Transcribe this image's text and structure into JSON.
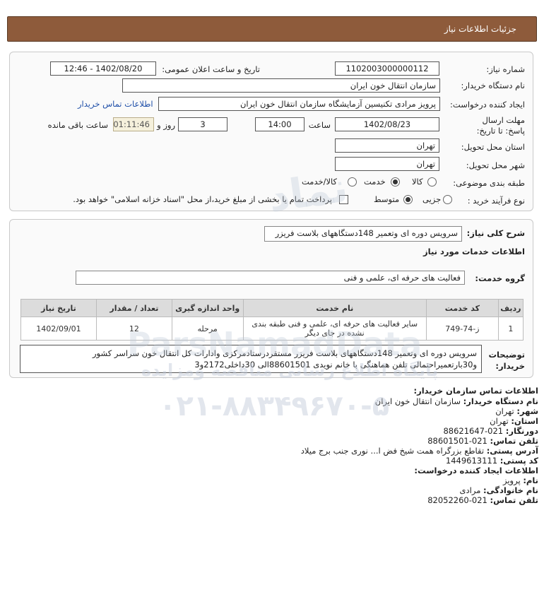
{
  "header": {
    "title": "جزئیات اطلاعات نیاز"
  },
  "need": {
    "need_number_label": "شماره نیاز:",
    "need_number": "1102003000000112",
    "announce_label": "تاریخ و ساعت اعلان عمومی:",
    "announce_value": "1402/08/20 - 12:46",
    "buyer_label": "نام دستگاه خریدار:",
    "buyer_value": "سازمان انتقال خون ایران",
    "creator_label": "ایجاد کننده درخواست:",
    "creator_value": "پرویز مرادی تکنیسین آزمایشگاه سازمان انتقال خون ایران",
    "contact_link": "اطلاعات تماس خریدار",
    "deadline_label": "مهلت ارسال پاسخ: تا تاریخ:",
    "deadline_date": "1402/08/23",
    "time_label": "ساعت",
    "deadline_time": "14:00",
    "days_value": "3",
    "days_label": "روز و",
    "remaining_time": "01:11:46",
    "remaining_label": "ساعت باقی مانده",
    "province_label": "استان محل تحویل:",
    "province_value": "تهران",
    "city_label": "شهر محل تحویل:",
    "city_value": "تهران",
    "category_label": "طبقه بندی موضوعی:",
    "category_options": [
      "کالا",
      "خدمت",
      "کالا/خدمت"
    ],
    "category_selected": "خدمت",
    "process_label": "نوع فرآیند خرید :",
    "process_options": [
      "جزیی",
      "متوسط"
    ],
    "process_selected": "متوسط",
    "payment_text": "پرداخت تمام یا بخشی از مبلغ خرید،از محل \"اسناد خزانه اسلامی\" خواهد بود."
  },
  "details": {
    "general_label": "شرح کلی نیاز:",
    "general_value": "سرویس دوره ای وتعمیر 148دستگاههای بلاست فریزر",
    "services_header": "اطلاعات خدمات مورد نیاز",
    "group_label": "گروه خدمت:",
    "group_value": "فعالیت های حرفه ای، علمی و فنی",
    "table": {
      "columns": [
        "ردیف",
        "کد خدمت",
        "نام خدمت",
        "واحد اندازه گیری",
        "تعداد / مقدار",
        "تاریخ نیاز"
      ],
      "rows": [
        {
          "row": "1",
          "code": "ز-74-749",
          "name": "سایر فعالیت های حرفه ای، علمی و فنی طبقه بندی نشده در جای دیگر",
          "unit": "مرحله",
          "qty": "12",
          "date": "1402/09/01"
        }
      ]
    },
    "buyer_desc_label": "توضیحات خریدار:",
    "buyer_desc": "سرویس دوره ای وتعمیر 148دستگاههای بلاست فریزر مستقردرستادمرکزی وادارات کل انتقال خون سراسر کشور و30بارتعمیراحتمالی تلفن هماهنگی با خانم نویدی 88601501الی 30داخلی2172و3"
  },
  "contact": {
    "heading": "اطلاعات تماس سازمان خریدار:",
    "items": [
      {
        "label": "نام دستگاه خریدار:",
        "value": "سازمان انتقال خون ایران"
      },
      {
        "label": "شهر:",
        "value": "تهران"
      },
      {
        "label": "استان:",
        "value": "تهران"
      },
      {
        "label": "دورنگار:",
        "value": "021-88621647"
      },
      {
        "label": "تلفن تماس:",
        "value": "021-88601501"
      },
      {
        "label": "آدرس پستی:",
        "value": "تقاطع بزرگراه همت شیخ فض ا... نوری جنب برج میلاد"
      },
      {
        "label": "کد پستی:",
        "value": "1449613111"
      }
    ],
    "creator_heading": "اطلاعات ایجاد کننده درخواست:",
    "creator_items": [
      {
        "label": "نام:",
        "value": "پرویز"
      },
      {
        "label": "نام خانوادگی:",
        "value": "مرادی"
      },
      {
        "label": "تلفن تماس:",
        "value": "021-82052260"
      }
    ]
  },
  "watermark": {
    "site": "ParsNamadData",
    "caption": "پایگاه اطلاع رسانی مناقصه ومزایده",
    "phone": "۰۲۱-۸۸۳۴۹۶۷۰-۵",
    "logo": "نماد"
  }
}
